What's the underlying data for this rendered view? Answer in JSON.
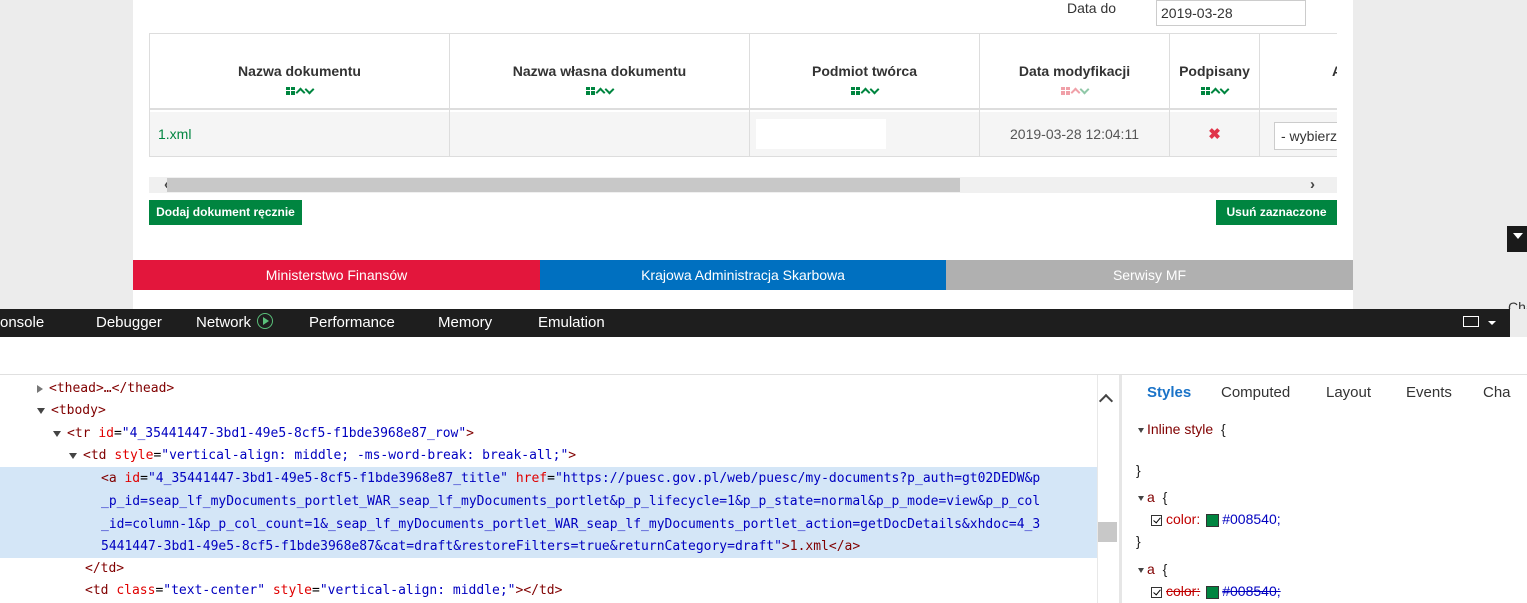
{
  "filter": {
    "date_to_label": "Data do",
    "date_to_value": "2019-03-28"
  },
  "table": {
    "headers": [
      "Nazwa dokumentu",
      "Nazwa własna dokumentu",
      "Podmiot twórca",
      "Data modyfikacji",
      "Podpisany",
      "Al"
    ],
    "row": {
      "document_name": "1.xml",
      "own_name": "",
      "creator": "",
      "modified": "2019-03-28 12:04:11",
      "signed": "✖",
      "action_select": "- wybierz"
    }
  },
  "buttons": {
    "add_manual": "Dodaj dokument ręcznie",
    "delete_selected": "Usuń zaznaczone"
  },
  "footer": {
    "seg1": "Ministerstwo Finansów",
    "seg2": "Krajowa Administracja Skarbowa",
    "seg3": "Serwisy MF"
  },
  "side_text": "Cha",
  "devtools": {
    "tabs": [
      "onsole",
      "Debugger",
      "Network",
      "Performance",
      "Memory",
      "Emulation"
    ],
    "dom_lines": {
      "l1_tag": "<thead>…</thead>",
      "l2_tag": "<tbody>",
      "l3_open": "<tr ",
      "l3_attr": "id",
      "l3_val": "\"4_35441447-3bd1-49e5-8cf5-f1bde3968e87_row\"",
      "l3_close": ">",
      "l4_open": "<td ",
      "l4_attr": "style",
      "l4_val": "\"vertical-align: middle; -ms-word-break: break-all;\"",
      "l4_close": ">",
      "l5_open": "<a ",
      "l5_attr1": "id",
      "l5_val1": "\"4_35441447-3bd1-49e5-8cf5-f1bde3968e87_title\"",
      "l5_attr2": "href",
      "l5_val2a": "\"https://puesc.gov.pl/web/puesc/my-documents?p_auth=gt02DEDW&p",
      "l6_text": "_p_id=seap_lf_myDocuments_portlet_WAR_seap_lf_myDocuments_portlet&p_p_lifecycle=1&p_p_state=normal&p_p_mode=view&p_p_col",
      "l7_text": "_id=column-1&p_p_col_count=1&_seap_lf_myDocuments_portlet_WAR_seap_lf_myDocuments_portlet_action=getDocDetails&xhdoc=4_3",
      "l8_val": "5441447-3bd1-49e5-8cf5-f1bde3968e87&cat=draft&restoreFilters=true&returnCategory=draft\"",
      "l8_close": ">1.xml</a>",
      "l9_tag": "</td>",
      "l10_open": "<td ",
      "l10_attr1": "class",
      "l10_val1": "\"text-center\"",
      "l10_attr2": "style",
      "l10_val2": "\"vertical-align: middle;\"",
      "l10_close": "></td>"
    },
    "style_tabs": [
      "Styles",
      "Computed",
      "Layout",
      "Events",
      "Cha"
    ],
    "styles": {
      "inline_label": "Inline style",
      "open_brace": "{",
      "close_brace": "}",
      "selector": "a",
      "prop": "color:",
      "value": "#008540;",
      "color": "#008540"
    }
  }
}
